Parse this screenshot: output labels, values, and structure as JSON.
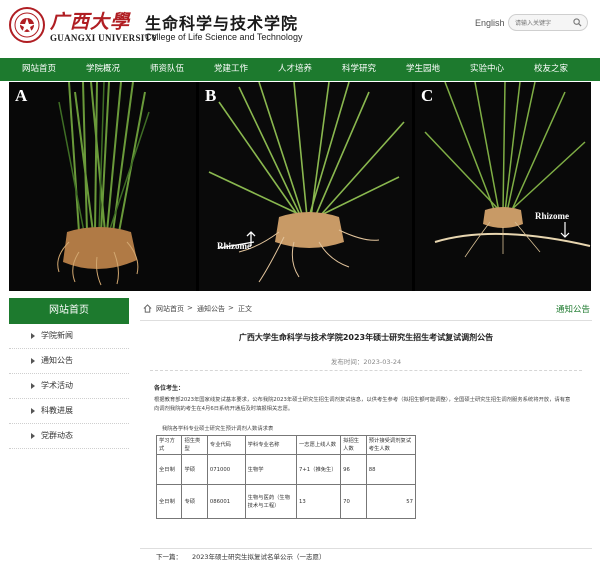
{
  "header": {
    "university_cn": "广西大學",
    "university_en": "GUANGXI UNIVERSITY",
    "college_cn": "生命科学与技术学院",
    "college_en": "College of Life Science and Technology",
    "language_link": "English",
    "search_placeholder": "请输入关键字"
  },
  "nav": {
    "items": [
      "网站首页",
      "学院概况",
      "师资队伍",
      "党建工作",
      "人才培养",
      "科学研究",
      "学生园地",
      "实验中心",
      "校友之家"
    ]
  },
  "banner": {
    "panels": [
      {
        "label": "A"
      },
      {
        "label": "B",
        "annotation": "Rhizome"
      },
      {
        "label": "C",
        "annotation": "Rhizome"
      }
    ]
  },
  "sidebar": {
    "title": "网站首页",
    "items": [
      "学院新闻",
      "通知公告",
      "学术活动",
      "科教进展",
      "党群动态"
    ]
  },
  "breadcrumb": {
    "items": [
      "网站首页",
      "通知公告",
      "正文"
    ],
    "separator": ">",
    "section_title": "通知公告"
  },
  "article": {
    "title": "广西大学生命科学与技术学院2023年硕士研究生招生考试复试调剂公告",
    "publish_label": "发布时间：",
    "publish_date": "2023-03-24",
    "greeting": "各位考生：",
    "paragraph": "根据教育部2023年国家线复试基本要求，公布我院2023年硕士研究生招生调剂复试信息，以供考生参考（拟招生额可能调整），全国硕士研究生招生调剂服务系统将开放，请有意向调剂我院的考生在4月6日系统开通后及时填报相关志愿。",
    "table_note": "我院各学科专业硕士研究生预计调剂人数请求表",
    "table": {
      "headers": [
        "学习方式",
        "招生类型",
        "专业代码",
        "学科专业名称",
        "一志愿上线人数",
        "拟招生人数",
        "预计接受调剂复试考生人数"
      ],
      "rows": [
        [
          "全日制",
          "学硕",
          "071000",
          "生物学",
          "7+1（推免生）",
          "96",
          "88"
        ],
        [
          "全日制",
          "专硕",
          "086001",
          "生物与医药（生物技术与工程）",
          "13",
          "70",
          "57"
        ]
      ]
    },
    "next_label": "下一篇：",
    "next_title": "2023年硕士研究生拟复试名单公示（一志愿）"
  },
  "colors": {
    "brand_green": "#1d7a2e",
    "seal_red": "#b01e23"
  }
}
